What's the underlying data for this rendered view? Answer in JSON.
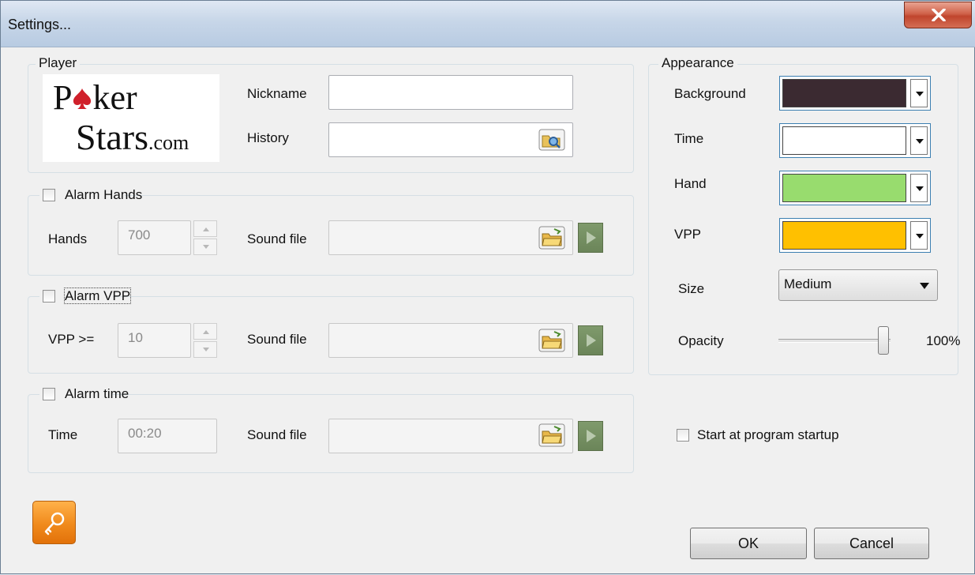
{
  "window": {
    "title": "Settings..."
  },
  "player": {
    "legend": "Player",
    "logo_line1_a": "P",
    "logo_line1_b": "ker",
    "logo_line2_a": "Stars",
    "logo_line2_b": ".com",
    "nickname_label": "Nickname",
    "nickname_value": "",
    "history_label": "History",
    "history_value": ""
  },
  "alarm_hands": {
    "label": "Alarm Hands",
    "checked": false,
    "hands_label": "Hands",
    "hands_value": "700",
    "sound_label": "Sound file",
    "sound_value": ""
  },
  "alarm_vpp": {
    "label": "Alarm VPP",
    "checked": false,
    "vpp_label": "VPP >=",
    "vpp_value": "10",
    "sound_label": "Sound file",
    "sound_value": ""
  },
  "alarm_time": {
    "label": "Alarm time",
    "checked": false,
    "time_label": "Time",
    "time_value": "00:20",
    "sound_label": "Sound file",
    "sound_value": ""
  },
  "appearance": {
    "legend": "Appearance",
    "background_label": "Background",
    "background_color": "#3b2a31",
    "time_label": "Time",
    "time_color": "#ffffff",
    "hand_label": "Hand",
    "hand_color": "#98dc6e",
    "vpp_label": "VPP",
    "vpp_color": "#ffc000",
    "size_label": "Size",
    "size_value": "Medium",
    "opacity_label": "Opacity",
    "opacity_value": "100%",
    "opacity_fraction": 1.0
  },
  "startup": {
    "label": "Start at program startup",
    "checked": false
  },
  "buttons": {
    "ok": "OK",
    "cancel": "Cancel"
  },
  "colors": {
    "play_button": "#6b8559",
    "key_button": "#f08a1c"
  }
}
